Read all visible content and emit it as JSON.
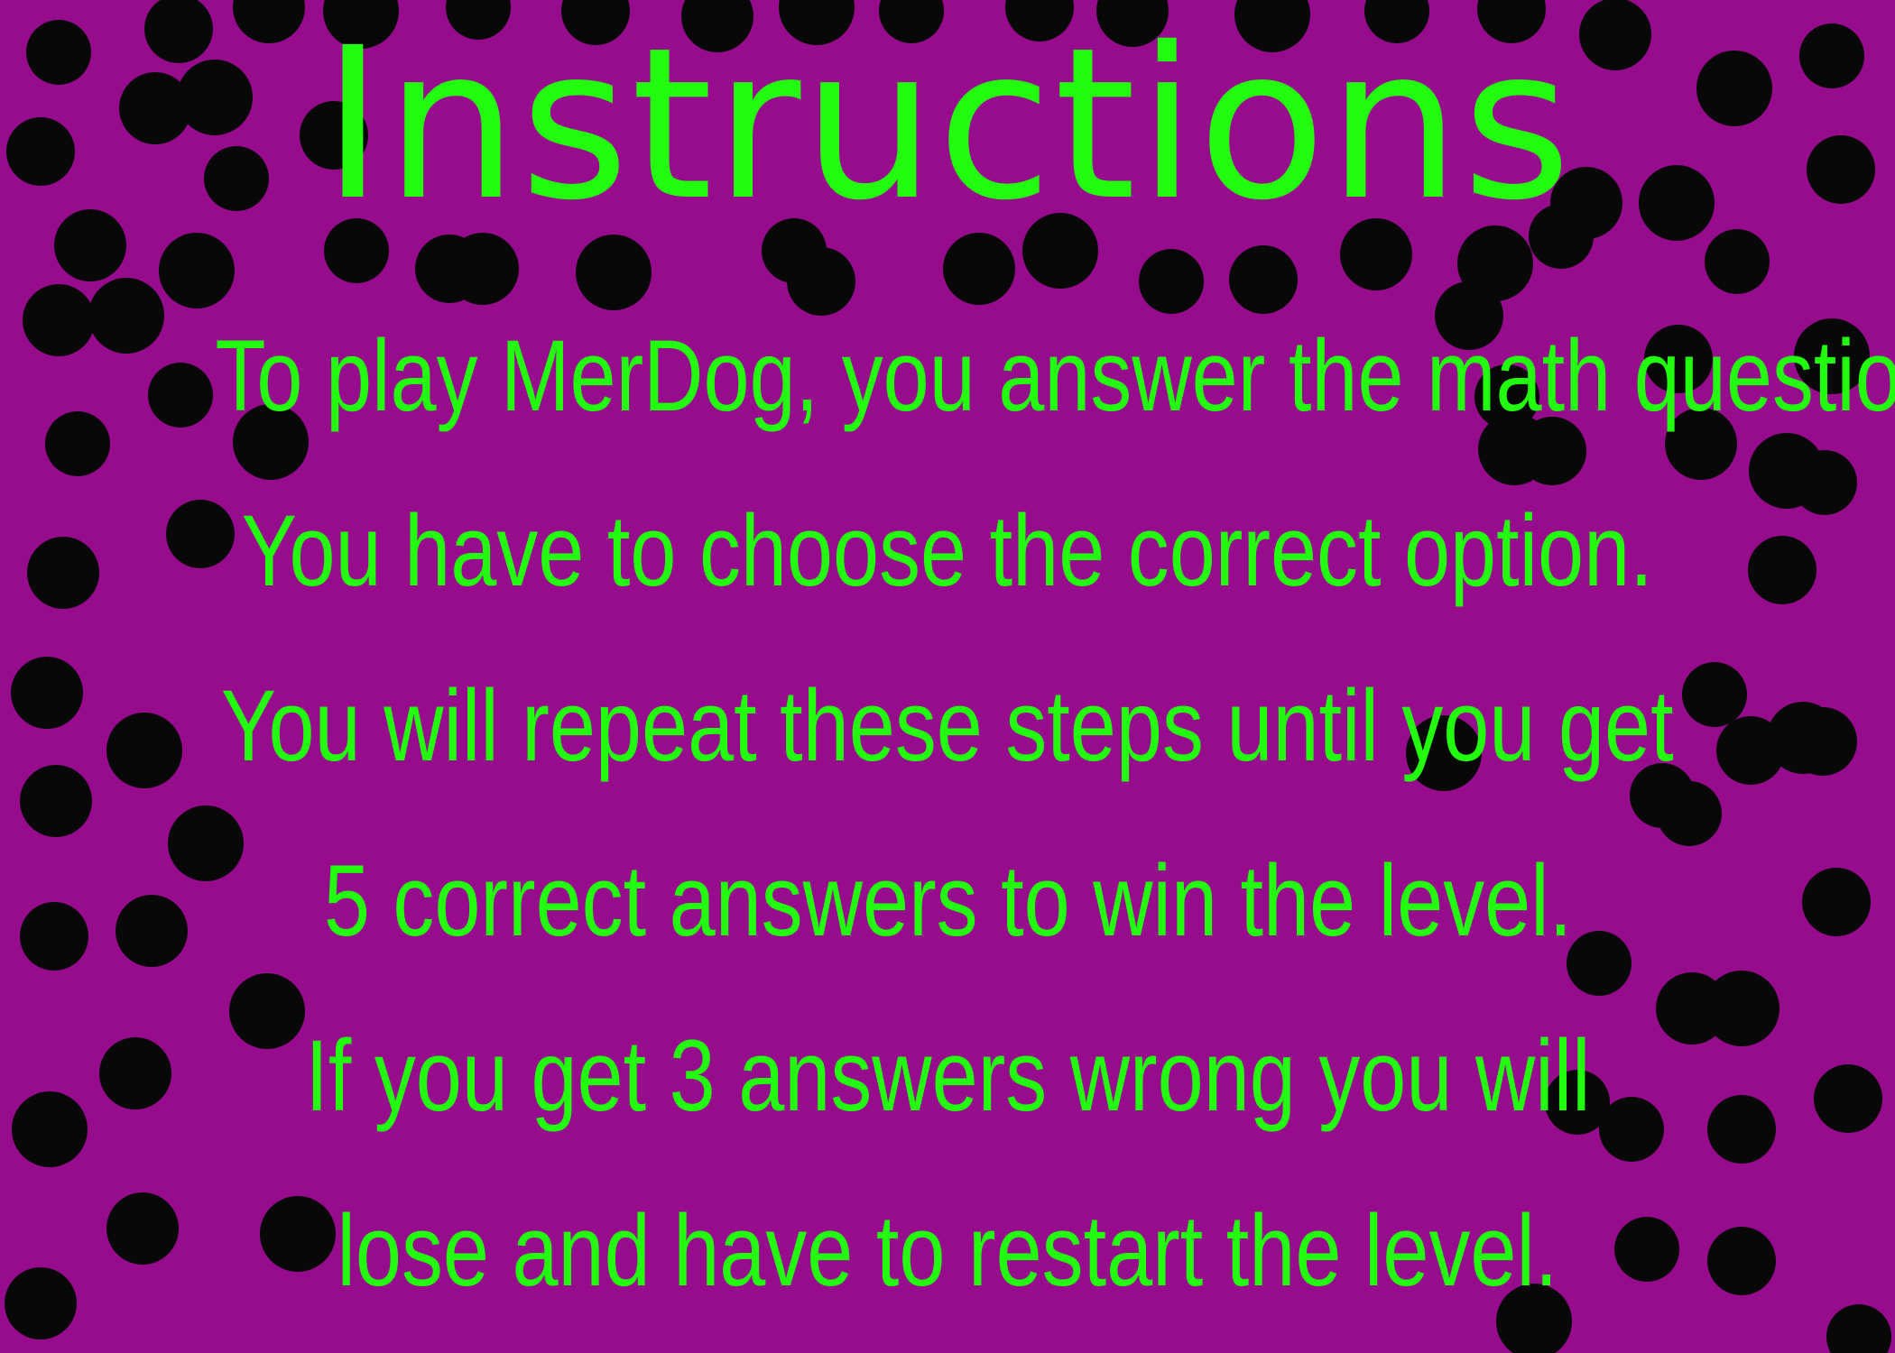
{
  "screen": {
    "background_color": "#960c8c",
    "text_color": "#22fc0e",
    "dot_color": "#080808"
  },
  "title": "Instructions",
  "instructions": [
    "To play MerDog, you answer the math questions.",
    "You have to choose the correct option.",
    "You will repeat these steps until you get",
    "5 correct answers to win the level.",
    "If you get 3 answers wrong you will",
    "lose and have to restart the level."
  ]
}
